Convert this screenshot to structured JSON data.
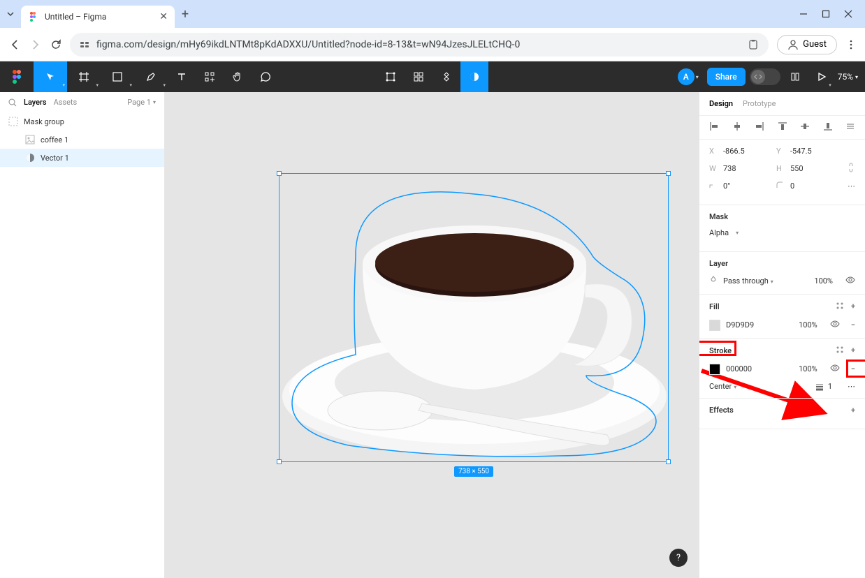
{
  "browser": {
    "tab_title": "Untitled – Figma",
    "url": "figma.com/design/mHy69ikdLNTMt8pKdADXXU/Untitled?node-id=8-13&t=wN94JzesJLELtCHQ-0",
    "guest_label": "Guest"
  },
  "toolbar": {
    "avatar_letter": "A",
    "share_label": "Share",
    "zoom": "75%"
  },
  "left_panel": {
    "tabs": {
      "layers": "Layers",
      "assets": "Assets"
    },
    "page_label": "Page 1",
    "layers": {
      "mask_group": "Mask group",
      "coffee": "coffee 1",
      "vector": "Vector 1"
    }
  },
  "canvas": {
    "selection_dims": "738 × 550"
  },
  "right_panel": {
    "tabs": {
      "design": "Design",
      "prototype": "Prototype"
    },
    "x": "-866.5",
    "y": "-547.5",
    "w": "738",
    "h": "550",
    "rotation": "0°",
    "corner": "0",
    "mask_title": "Mask",
    "mask_mode": "Alpha",
    "layer_title": "Layer",
    "blend_mode": "Pass through",
    "layer_opacity": "100%",
    "fill_title": "Fill",
    "fill_hex": "D9D9D9",
    "fill_opacity": "100%",
    "stroke_title": "Stroke",
    "stroke_hex": "000000",
    "stroke_opacity": "100%",
    "stroke_align": "Center",
    "stroke_weight": "1",
    "effects_title": "Effects"
  }
}
